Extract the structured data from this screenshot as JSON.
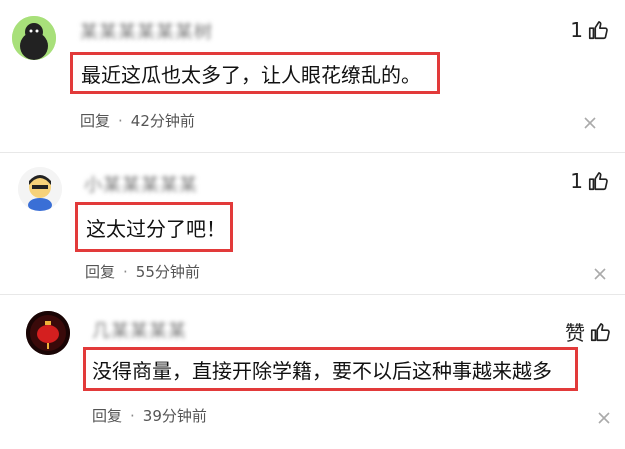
{
  "comments": [
    {
      "username": "某某某某某某树",
      "likes": "1",
      "text": "最近这瓜也太多了，让人眼花缭乱的。",
      "reply_label": "回复",
      "separator": "·",
      "time": "42分钟前",
      "avatar": "penguin-avatar"
    },
    {
      "username": "小某某某某某",
      "likes": "1",
      "text": "这太过分了吧！",
      "reply_label": "回复",
      "separator": "·",
      "time": "55分钟前",
      "avatar": "cartoon-avatar"
    },
    {
      "username": "几某某某某",
      "likes": "赞",
      "text": "没得商量，直接开除学籍，要不以后这种事越来越多",
      "reply_label": "回复",
      "separator": "·",
      "time": "39分钟前",
      "avatar": "red-lantern-avatar"
    }
  ],
  "colors": {
    "highlight_border": "#e23a3a",
    "meta_text": "#555555"
  },
  "icons": {
    "like": "thumbs-up-icon",
    "close": "close-icon"
  }
}
